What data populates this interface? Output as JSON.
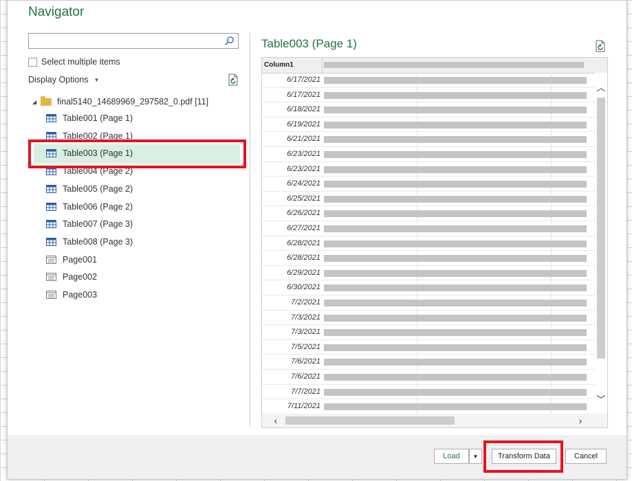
{
  "window": {
    "title": "Navigator"
  },
  "search": {
    "value": "",
    "placeholder": ""
  },
  "options": {
    "select_multiple_label": "Select multiple items",
    "display_options_label": "Display Options"
  },
  "tree": {
    "folder": {
      "label": "final5140_14689969_297582_0.pdf [11]",
      "icon": "folder-icon"
    },
    "items": [
      {
        "label": "Table001 (Page 1)",
        "icon": "table-icon"
      },
      {
        "label": "Table002 (Page 1)",
        "icon": "table-icon"
      },
      {
        "label": "Table003 (Page 1)",
        "icon": "table-icon",
        "selected": true
      },
      {
        "label": "Table004 (Page 2)",
        "icon": "table-icon"
      },
      {
        "label": "Table005 (Page 2)",
        "icon": "table-icon"
      },
      {
        "label": "Table006 (Page 2)",
        "icon": "table-icon"
      },
      {
        "label": "Table007 (Page 3)",
        "icon": "table-icon"
      },
      {
        "label": "Table008 (Page 3)",
        "icon": "table-icon"
      },
      {
        "label": "Page001",
        "icon": "page-icon"
      },
      {
        "label": "Page002",
        "icon": "page-icon"
      },
      {
        "label": "Page003",
        "icon": "page-icon"
      }
    ]
  },
  "preview": {
    "title": "Table003 (Page 1)",
    "column_header": "Column1",
    "dates": [
      "6/17/2021",
      "6/17/2021",
      "6/18/2021",
      "6/19/2021",
      "6/21/2021",
      "6/23/2021",
      "6/23/2021",
      "6/24/2021",
      "6/25/2021",
      "6/26/2021",
      "6/27/2021",
      "6/28/2021",
      "6/28/2021",
      "6/29/2021",
      "6/30/2021",
      "7/2/2021",
      "7/3/2021",
      "7/3/2021",
      "7/5/2021",
      "7/6/2021",
      "7/6/2021",
      "7/7/2021",
      "7/11/2021"
    ]
  },
  "footer": {
    "load_label": "Load",
    "transform_label": "Transform Data",
    "cancel_label": "Cancel"
  },
  "colors": {
    "accent": "#217346",
    "highlight": "#e8121f",
    "selection": "#d8f0e1"
  }
}
